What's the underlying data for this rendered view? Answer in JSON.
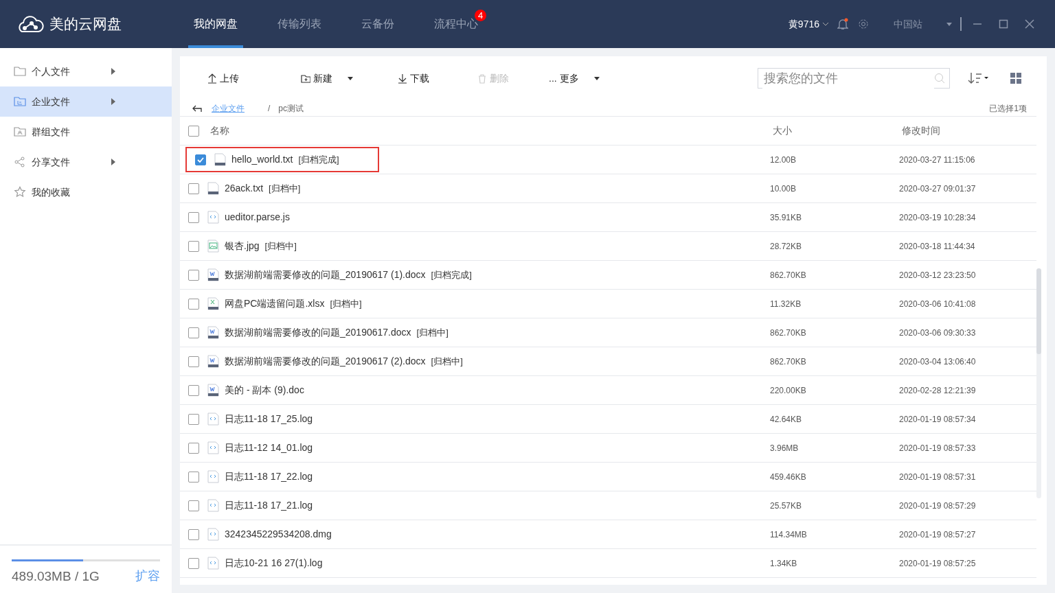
{
  "app": {
    "title": "美的云网盘"
  },
  "nav_tabs": [
    {
      "label": "我的网盘",
      "selected": true
    },
    {
      "label": "传输列表",
      "selected": false
    },
    {
      "label": "云备份",
      "selected": false
    },
    {
      "label": "流程中心",
      "selected": false,
      "badge": "4"
    }
  ],
  "user": {
    "name": "黄9716",
    "has_notification": true
  },
  "region": {
    "value": "中国站"
  },
  "sidebar": {
    "items": [
      {
        "label": "个人文件",
        "selected": false,
        "has_submenu": true
      },
      {
        "label": "企业文件",
        "selected": true,
        "has_submenu": true
      },
      {
        "label": "群组文件",
        "selected": false,
        "has_submenu": false
      },
      {
        "label": "分享文件",
        "selected": false,
        "has_submenu": true
      },
      {
        "label": "我的收藏",
        "selected": false,
        "has_submenu": false
      }
    ],
    "storage": {
      "level": 0.48,
      "text": "489.03MB / 1G",
      "action": "扩容"
    }
  },
  "toolbar": [
    {
      "label": "上传",
      "disabled": false,
      "dropdown": false
    },
    {
      "label": "新建",
      "disabled": false,
      "dropdown": true
    },
    {
      "label": "下载",
      "disabled": false,
      "dropdown": false
    },
    {
      "label": "删除",
      "disabled": true,
      "dropdown": false
    },
    {
      "label": "... 更多",
      "disabled": false,
      "dropdown": true
    }
  ],
  "search": {
    "placeholder": "搜索您的文件"
  },
  "breadcrumb": {
    "separator": "/",
    "items": [
      {
        "label": "企业文件",
        "link": true
      },
      {
        "label": "pc测试",
        "link": false
      }
    ]
  },
  "selection_text": "已选择1项",
  "table": {
    "select_all": {
      "checked": false
    },
    "columns": [
      "名称",
      "大小",
      "修改时间"
    ],
    "rows": [
      {
        "kind": "txt",
        "name": "hello_world.txt",
        "tag": "[归档完成]",
        "size": "12.00B",
        "modified": "2020-03-27 11:15:06",
        "selected": true
      },
      {
        "kind": "txt",
        "name": "26ack.txt",
        "tag": "[归档中]",
        "size": "10.00B",
        "modified": "2020-03-27 09:01:37",
        "selected": false
      },
      {
        "kind": "code",
        "name": "ueditor.parse.js",
        "size": "35.91KB",
        "modified": "2020-03-19 10:28:34",
        "selected": false
      },
      {
        "kind": "image",
        "name": "银杏.jpg",
        "tag": "[归档中]",
        "size": "28.72KB",
        "modified": "2020-03-18 11:44:34",
        "selected": false
      },
      {
        "kind": "word",
        "name": "数据湖前端需要修改的问题_20190617 (1).docx",
        "tag": "[归档完成]",
        "size": "862.70KB",
        "modified": "2020-03-12 23:23:50",
        "selected": false
      },
      {
        "kind": "excel",
        "name": "网盘PC端遗留问题.xlsx",
        "tag": "[归档中]",
        "size": "11.32KB",
        "modified": "2020-03-06 10:41:08",
        "selected": false
      },
      {
        "kind": "word",
        "name": "数据湖前端需要修改的问题_20190617.docx",
        "tag": "[归档中]",
        "size": "862.70KB",
        "modified": "2020-03-06 09:30:33",
        "selected": false
      },
      {
        "kind": "word",
        "name": "数据湖前端需要修改的问题_20190617 (2).docx",
        "tag": "[归档中]",
        "size": "862.70KB",
        "modified": "2020-03-04 13:06:40",
        "selected": false
      },
      {
        "kind": "word",
        "name": "美的 - 副本 (9).doc",
        "size": "220.00KB",
        "modified": "2020-02-28 12:21:39",
        "selected": false
      },
      {
        "kind": "code",
        "name": "日志11-18 17_25.log",
        "size": "42.64KB",
        "modified": "2020-01-19 08:57:34",
        "selected": false
      },
      {
        "kind": "code",
        "name": "日志11-12 14_01.log",
        "size": "3.96MB",
        "modified": "2020-01-19 08:57:33",
        "selected": false
      },
      {
        "kind": "code",
        "name": "日志11-18 17_22.log",
        "size": "459.46KB",
        "modified": "2020-01-19 08:57:31",
        "selected": false
      },
      {
        "kind": "code",
        "name": "日志11-18 17_21.log",
        "size": "25.57KB",
        "modified": "2020-01-19 08:57:29",
        "selected": false
      },
      {
        "kind": "code",
        "name": "3242345229534208.dmg",
        "size": "114.34MB",
        "modified": "2020-01-19 08:57:27",
        "selected": false
      },
      {
        "kind": "code",
        "name": "日志10-21 16 27(1).log",
        "size": "1.34KB",
        "modified": "2020-01-19 08:57:25",
        "selected": false
      }
    ]
  }
}
